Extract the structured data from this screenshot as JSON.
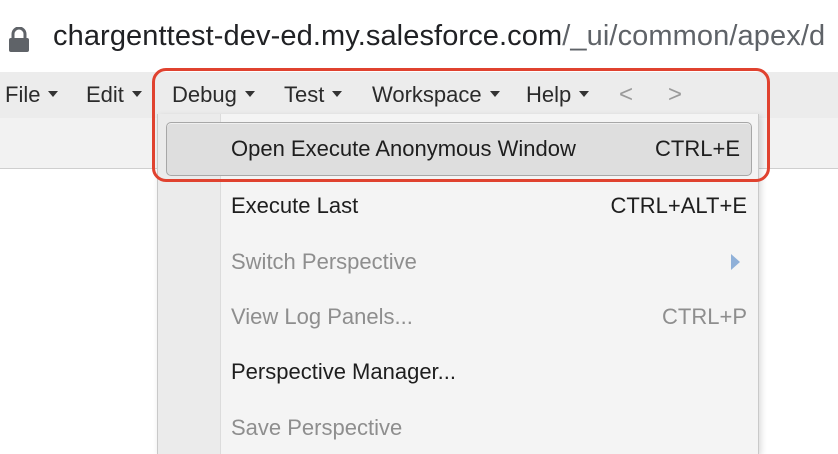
{
  "browser": {
    "url_domain": "chargenttest-dev-ed.my.salesforce.com",
    "url_path": "/_ui/common/apex/d",
    "lock_icon": "lock-icon"
  },
  "menubar": {
    "items": [
      {
        "label": "File"
      },
      {
        "label": "Edit"
      },
      {
        "label": "Debug"
      },
      {
        "label": "Test"
      },
      {
        "label": "Workspace"
      },
      {
        "label": "Help"
      }
    ],
    "back_arrow": "<",
    "forward_arrow": ">"
  },
  "debug_menu": {
    "items": [
      {
        "label": "Open Execute Anonymous Window",
        "shortcut": "CTRL+E",
        "state": "highlighted"
      },
      {
        "label": "Execute Last",
        "shortcut": "CTRL+ALT+E",
        "state": "enabled"
      },
      {
        "label": "Switch Perspective",
        "shortcut": "",
        "state": "disabled"
      },
      {
        "label": "View Log Panels...",
        "shortcut": "CTRL+P",
        "state": "disabled"
      },
      {
        "label": "Perspective Manager...",
        "shortcut": "",
        "state": "enabled"
      },
      {
        "label": "Save Perspective",
        "shortcut": "",
        "state": "disabled"
      }
    ]
  },
  "colors": {
    "annotation": "#e0422f",
    "menubar_bg": "#ececec",
    "highlight_bg": "#dedede",
    "disabled_text": "#8e8e8e",
    "submenu_arrow": "#8fb0d8"
  }
}
